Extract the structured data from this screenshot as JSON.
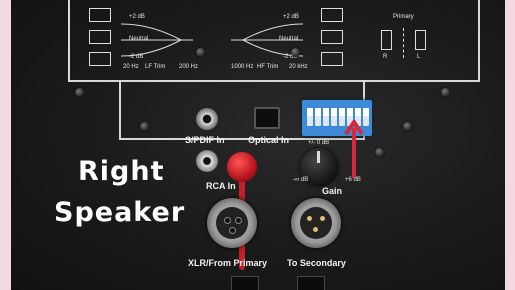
{
  "panel": {
    "lf_trim_label": "LF Trim",
    "hf_trim_label": "HF Trim",
    "plus2db": "+2 dB",
    "neutral": "Neutral",
    "minus2db": "-2 dB",
    "lf_freqs": [
      "20 Hz",
      "200 Hz"
    ],
    "hf_freqs": [
      "1000 Hz",
      "20 kHz"
    ],
    "primary_label": "Primary",
    "primary_r": "R",
    "primary_l": "L",
    "spdif_label": "S/PDIF In",
    "optical_label": "Optical In",
    "rca_label": "RCA In",
    "gain_label": "Gain",
    "gain_zero": "+/- 0 dB",
    "gain_min": "-∞ dB",
    "gain_max": "+6 dB",
    "xlr_from_label": "XLR/From Primary",
    "to_secondary_label": "To Secondary"
  },
  "overlay": {
    "line1": "Right",
    "line2": "Speaker"
  },
  "colors": {
    "background": "#f4d9e3",
    "dip_switch": "#3d8bd8",
    "arrow": "#d8263a",
    "cable": "#c0202a"
  }
}
